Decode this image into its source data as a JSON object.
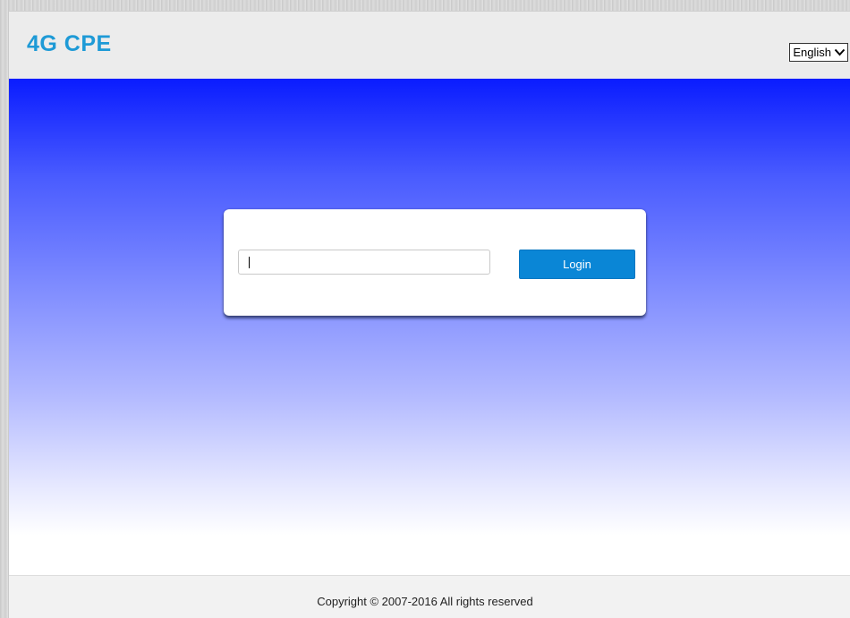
{
  "header": {
    "logo_text": "4G CPE",
    "language": {
      "selected": "English",
      "icon": "chevron-down-icon"
    }
  },
  "login": {
    "password_value": "",
    "password_placeholder": "",
    "button_label": "Login"
  },
  "footer": {
    "copyright": "Copyright © 2007-2016 All rights reserved"
  },
  "colors": {
    "brand": "#1e9ad6",
    "button": "#0a86d6",
    "hero_top": "#0a1cff"
  }
}
